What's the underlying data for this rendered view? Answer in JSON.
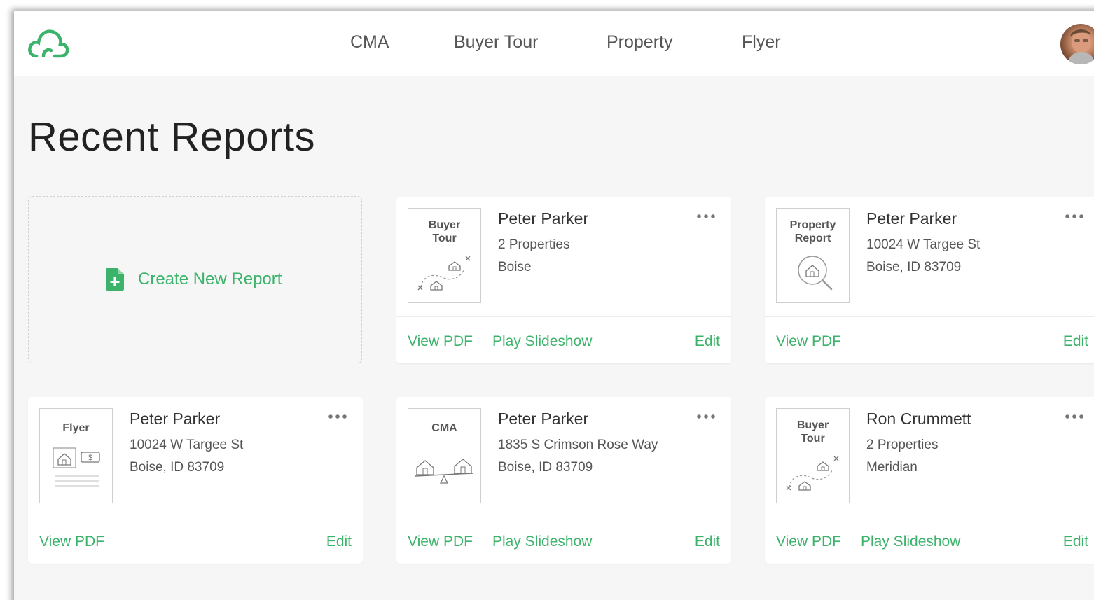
{
  "nav": {
    "items": [
      "CMA",
      "Buyer Tour",
      "Property",
      "Flyer"
    ]
  },
  "page": {
    "title": "Recent Reports"
  },
  "create": {
    "label": "Create New Report"
  },
  "colors": {
    "accent": "#3bb36a",
    "background": "#f6f6f6",
    "card": "#ffffff"
  },
  "cards": [
    {
      "thumb_label_1": "Buyer",
      "thumb_label_2": "Tour",
      "thumb_icon": "buyer-tour-map-icon",
      "name": "Peter Parker",
      "line1": "2 Properties",
      "line2": "Boise",
      "view_pdf": "View PDF",
      "slideshow": "Play Slideshow",
      "edit": "Edit"
    },
    {
      "thumb_label_1": "Property",
      "thumb_label_2": "Report",
      "thumb_icon": "property-search-icon",
      "name": "Peter Parker",
      "line1": "10024 W Targee St",
      "line2": "Boise, ID 83709",
      "view_pdf": "View PDF",
      "edit": "Edit"
    },
    {
      "thumb_label_1": "Flyer",
      "thumb_label_2": "",
      "thumb_icon": "flyer-house-price-icon",
      "name": "Peter Parker",
      "line1": "10024 W Targee St",
      "line2": "Boise, ID 83709",
      "view_pdf": "View PDF",
      "edit": "Edit"
    },
    {
      "thumb_label_1": "CMA",
      "thumb_label_2": "",
      "thumb_icon": "cma-scale-icon",
      "name": "Peter Parker",
      "line1": "1835 S Crimson Rose Way",
      "line2": "Boise, ID 83709",
      "view_pdf": "View PDF",
      "slideshow": "Play Slideshow",
      "edit": "Edit"
    },
    {
      "thumb_label_1": "Buyer",
      "thumb_label_2": "Tour",
      "thumb_icon": "buyer-tour-map-icon",
      "name": "Ron Crummett",
      "line1": "2 Properties",
      "line2": "Meridian",
      "view_pdf": "View PDF",
      "slideshow": "Play Slideshow",
      "edit": "Edit"
    }
  ]
}
